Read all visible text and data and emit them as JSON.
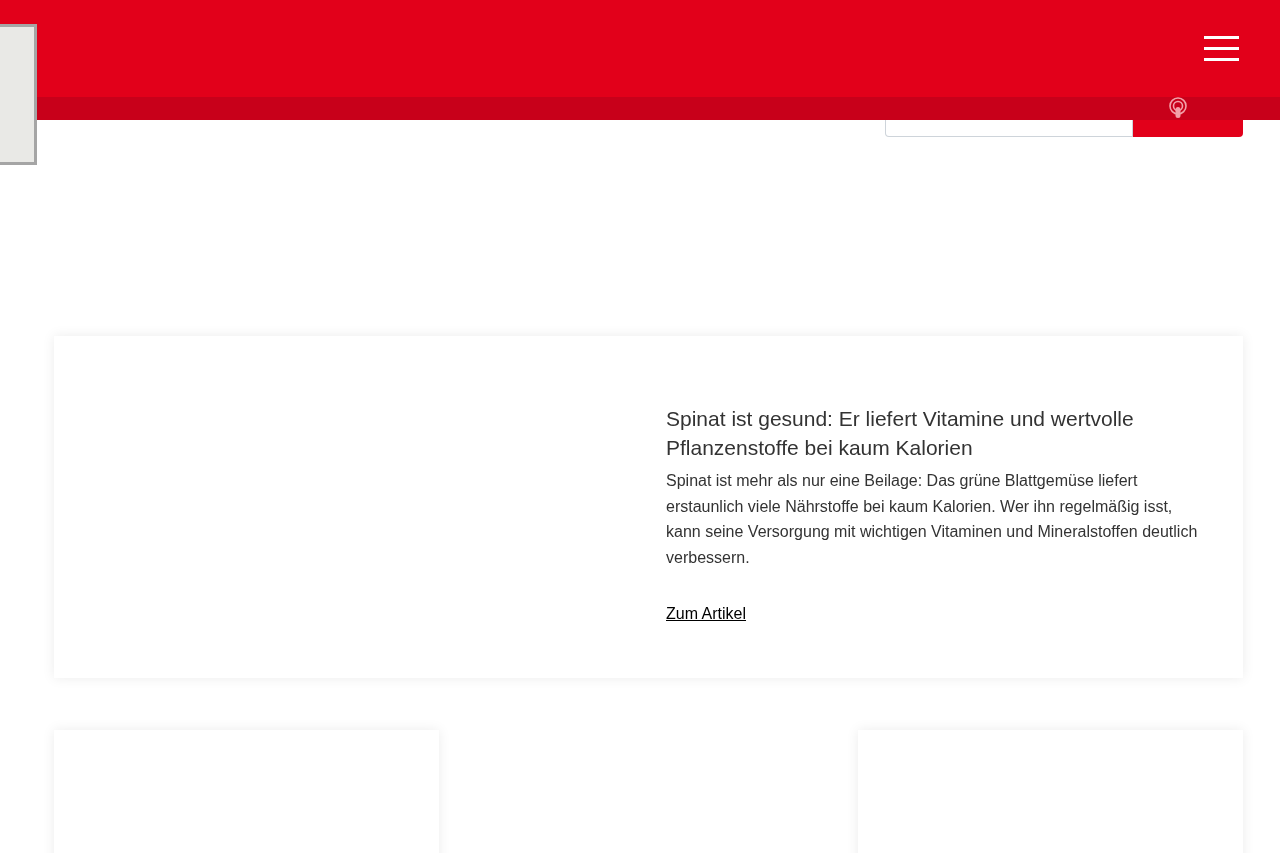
{
  "feature_article": {
    "title": "Spinat ist gesund: Er liefert Vitamine und wertvolle Pflanzenstoffe bei kaum Kalorien",
    "teaser": "Spinat ist mehr als nur eine Beilage: Das grüne Blattgemüse liefert erstaunlich viele Nährstoffe bei kaum Kalorien. Wer ihn regelmäßig isst, kann seine Versorgung mit wichtigen Vitaminen und Mineralstoffen deutlich verbessern.",
    "link": "Zum Artikel"
  },
  "article_cards": [
    {
      "kind": "card"
    },
    {
      "kind": "gap"
    },
    {
      "kind": "card"
    }
  ]
}
